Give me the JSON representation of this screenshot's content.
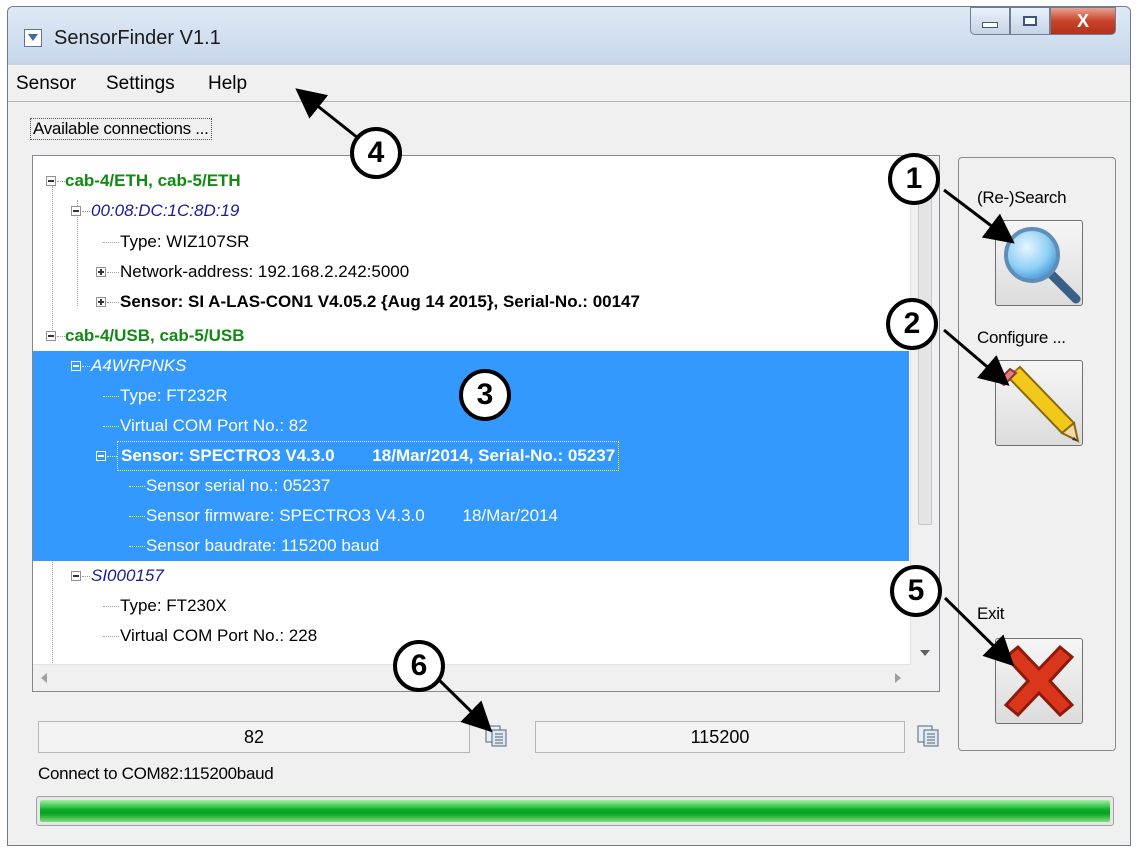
{
  "window": {
    "title": "SensorFinder V1.1",
    "close_label": "X"
  },
  "menu": {
    "items": [
      "Sensor",
      "Settings",
      "Help"
    ]
  },
  "connections": {
    "group_label": "Available connections ..."
  },
  "tree": [
    "cab-4/ETH, cab-5/ETH",
    "00:08:DC:1C:8D:19",
    "Type: WIZ107SR",
    "Network-address: 192.168.2.242:5000",
    "Sensor: SI A-LAS-CON1 V4.05.2 {Aug 14 2015}, Serial-No.: 00147",
    "cab-4/USB, cab-5/USB",
    "A4WRPNKS",
    "Type: FT232R",
    "Virtual COM Port No.: 82",
    "Sensor: SPECTRO3 V4.3.0        18/Mar/2014, Serial-No.: 05237",
    "Sensor serial no.: 05237",
    "Sensor firmware: SPECTRO3 V4.3.0        18/Mar/2014",
    "Sensor baudrate: 115200 baud",
    "SI000157",
    "Type: FT230X",
    "Virtual COM Port No.: 228"
  ],
  "buttons": {
    "search_label": "(Re-)Search",
    "configure_label": "Configure ...",
    "exit_label": "Exit"
  },
  "fields": {
    "com_port": "82",
    "baudrate": "115200"
  },
  "status": {
    "text": "Connect to COM82:115200baud",
    "progress_percent": 100
  },
  "callouts": [
    "1",
    "2",
    "3",
    "4",
    "5",
    "6"
  ],
  "colors": {
    "selection": "#3399ff",
    "group_text": "#128a12",
    "device_text": "#1b1b9e",
    "progress": "#06b025",
    "exit_x": "#d9361b"
  }
}
